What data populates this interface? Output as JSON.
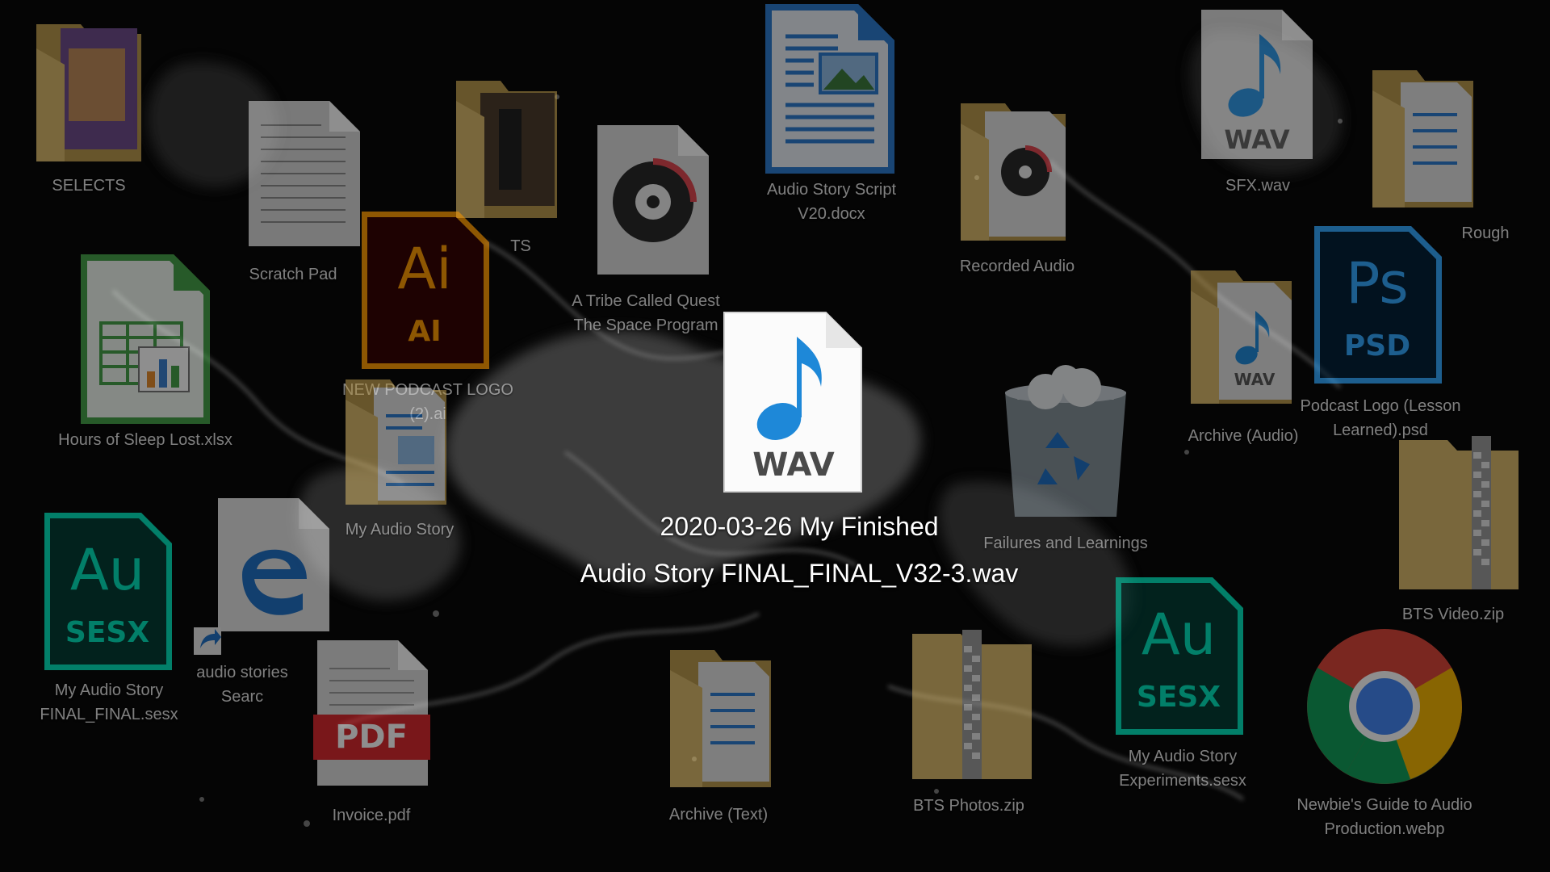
{
  "desktop": {
    "focused_file": {
      "name_line1": "2020-03-26 My Finished",
      "name_line2": "Audio Story FINAL_FINAL_V32-3.wav",
      "badge": "WAV",
      "icon": "wav-audio-file-icon"
    },
    "icons": [
      {
        "key": "selects",
        "label": "SELECTS",
        "icon": "folder-icon"
      },
      {
        "key": "scratch_pad",
        "label": "Scratch Pad",
        "icon": "text-document-icon"
      },
      {
        "key": "ts",
        "label": "TS",
        "icon": "folder-icon"
      },
      {
        "key": "tribe",
        "label_line1": "A Tribe Called Quest",
        "label_line2": "The Space Program",
        "icon": "audio-file-icon"
      },
      {
        "key": "script",
        "label_line1": "Audio Story Script",
        "label_line2": "V20.docx",
        "icon": "writer-document-icon"
      },
      {
        "key": "recorded",
        "label": "Recorded Audio",
        "icon": "folder-icon"
      },
      {
        "key": "sfx",
        "label": "SFX.wav",
        "badge": "WAV",
        "icon": "wav-file-icon"
      },
      {
        "key": "rough",
        "label": "Rough",
        "icon": "folder-icon"
      },
      {
        "key": "sleep",
        "label": "Hours of Sleep Lost.xlsx",
        "icon": "spreadsheet-icon"
      },
      {
        "key": "ai_logo",
        "label_line1": "NEW PODCAST LOGO",
        "label_line2": "(2).ai",
        "badge_top": "Ai",
        "badge_bottom": "AI",
        "icon": "illustrator-file-icon"
      },
      {
        "key": "my_story",
        "label": "My Audio Story",
        "icon": "folder-icon"
      },
      {
        "key": "archive_audio",
        "label": "Archive (Audio)",
        "badge": "WAV",
        "icon": "folder-icon"
      },
      {
        "key": "psd_logo",
        "label_line1": "Podcast Logo (Lesson",
        "label_line2": "Learned).psd",
        "badge_top": "Ps",
        "badge_bottom": "PSD",
        "icon": "photoshop-file-icon"
      },
      {
        "key": "recycle",
        "label": "Failures and Learnings",
        "icon": "recycle-bin-icon"
      },
      {
        "key": "au_final",
        "label_line1": "My Audio Story",
        "label_line2": "FINAL_FINAL.sesx",
        "badge_top": "Au",
        "badge_bottom": "SESX",
        "icon": "audition-file-icon"
      },
      {
        "key": "edge",
        "label_line1": "audio stories",
        "label_line2": "Searc",
        "icon": "edge-shortcut-icon"
      },
      {
        "key": "invoice",
        "label": "Invoice.pdf",
        "badge": "PDF",
        "icon": "pdf-file-icon"
      },
      {
        "key": "archive_text",
        "label": "Archive (Text)",
        "icon": "folder-icon"
      },
      {
        "key": "bts_photos",
        "label": "BTS Photos.zip",
        "icon": "zip-folder-icon"
      },
      {
        "key": "au_exp",
        "label_line1": "My Audio Story",
        "label_line2": "Experiments.sesx",
        "badge_top": "Au",
        "badge_bottom": "SESX",
        "icon": "audition-file-icon"
      },
      {
        "key": "bts_video",
        "label": "BTS Video.zip",
        "icon": "zip-folder-icon"
      },
      {
        "key": "chrome",
        "label_line1": "Newbie's Guide to Audio",
        "label_line2": "Production.webp",
        "icon": "chrome-icon"
      }
    ],
    "colors": {
      "folder": "#d8b86a",
      "folder_dark": "#b8974a",
      "illustrator": "#ff9a00",
      "photoshop": "#31a8ff",
      "audition": "#00e4bb",
      "pdf": "#d9262c",
      "wav_blue": "#1e88d8"
    }
  }
}
